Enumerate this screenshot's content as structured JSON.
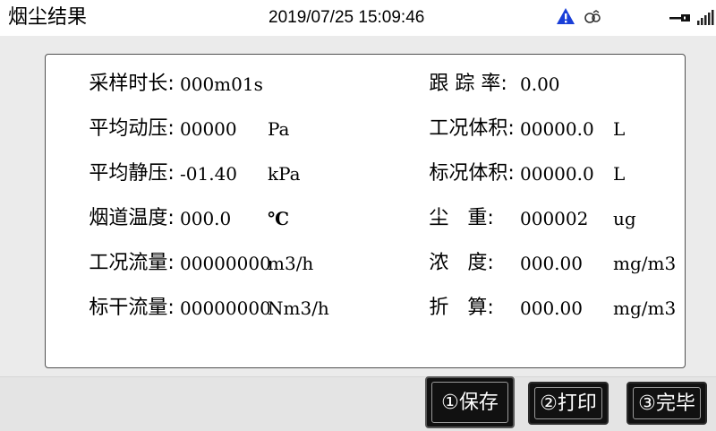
{
  "header": {
    "title": "烟尘结果",
    "datetime": "2019/07/25 15:09:46",
    "icons": [
      "warning-icon",
      "link-icon",
      "usb-icon",
      "signal-icon"
    ],
    "warning_color": "#1a3fd8"
  },
  "results": {
    "left": [
      {
        "label": "采样时长:",
        "value": "000m01s",
        "unit": ""
      },
      {
        "label": "平均动压:",
        "value": "00000",
        "unit": "Pa"
      },
      {
        "label": "平均静压:",
        "value": "-01.40",
        "unit": "kPa"
      },
      {
        "label": "烟道温度:",
        "value": "000.0",
        "unit": "℃"
      },
      {
        "label": "工况流量:",
        "value": "00000000",
        "unit": "m3/h"
      },
      {
        "label": "标干流量:",
        "value": "00000000",
        "unit": "Nm3/h"
      }
    ],
    "right": [
      {
        "label": "跟 踪 率:",
        "value": "0.00",
        "unit": ""
      },
      {
        "label": "工况体积:",
        "value": "00000.0",
        "unit": "L"
      },
      {
        "label": "标况体积:",
        "value": "00000.0",
        "unit": "L"
      },
      {
        "label": "尘   重:",
        "value": "000002",
        "unit": "ug"
      },
      {
        "label": "浓   度:",
        "value": "000.00",
        "unit": "mg/m3"
      },
      {
        "label": "折   算:",
        "value": "000.00",
        "unit": "mg/m3"
      }
    ]
  },
  "buttons": {
    "save": "①保存",
    "print": "②打印",
    "finish": "③完毕"
  }
}
